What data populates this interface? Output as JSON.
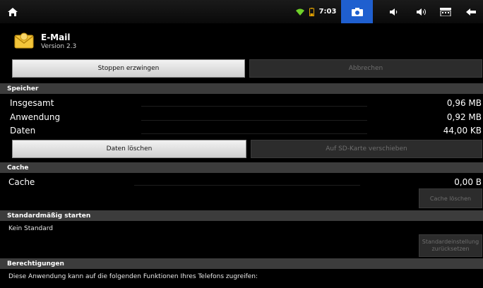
{
  "status_bar": {
    "time": "7:03",
    "icons": [
      "home-icon",
      "wifi-icon",
      "battery-icon",
      "camera-icon",
      "volume-down-icon",
      "volume-up-icon",
      "menu-icon",
      "back-icon"
    ],
    "camera_bg": "#1f5fcf"
  },
  "app": {
    "name": "E-Mail",
    "version": "Version 2.3"
  },
  "buttons": {
    "force_stop": "Stoppen erzwingen",
    "cancel": "Abbrechen",
    "clear_data": "Daten löschen",
    "move_to_sd": "Auf SD-Karte verschieben",
    "clear_cache": "Cache löschen",
    "reset_defaults": "Standardeinstellung zurücksetzen"
  },
  "storage": {
    "header": "Speicher",
    "rows": [
      {
        "label": "Insgesamt",
        "value": "0,96 MB"
      },
      {
        "label": "Anwendung",
        "value": "0,92 MB"
      },
      {
        "label": "Daten",
        "value": "44,00 KB"
      }
    ]
  },
  "cache": {
    "header": "Cache",
    "label": "Cache",
    "value": "0,00 B"
  },
  "launch_default": {
    "header": "Standardmäßig starten",
    "text": "Kein Standard"
  },
  "permissions": {
    "header": "Berechtigungen",
    "text": "Diese Anwendung kann auf die folgenden Funktionen Ihres Telefons zugreifen:"
  }
}
